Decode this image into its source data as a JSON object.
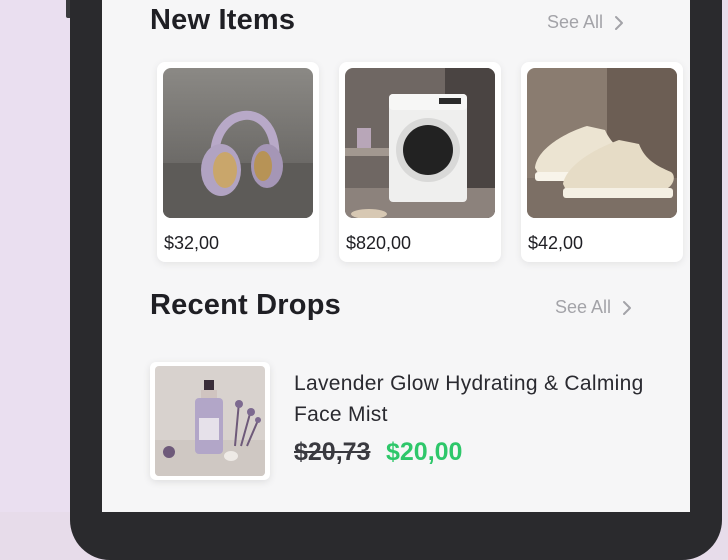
{
  "colors": {
    "accent_green": "#2ec76a",
    "text_primary": "#1f1f24",
    "text_muted": "#a3a3a8",
    "screen_bg": "#f6f6f7"
  },
  "new_items": {
    "title": "New Items",
    "see_all_label": "See All",
    "see_all_icon": "chevron-right-icon",
    "items": [
      {
        "image": "headphones",
        "price": "$32,00"
      },
      {
        "image": "washing-machine",
        "price": "$820,00"
      },
      {
        "image": "sneakers",
        "price": "$42,00"
      }
    ]
  },
  "recent_drops": {
    "title": "Recent Drops",
    "see_all_label": "See All",
    "see_all_icon": "chevron-right-icon",
    "items": [
      {
        "image": "face-mist-bottle",
        "name": "Lavender Glow Hydrating & Calming Face Mist",
        "old_price": "$20,73",
        "price": "$20,00"
      }
    ]
  }
}
